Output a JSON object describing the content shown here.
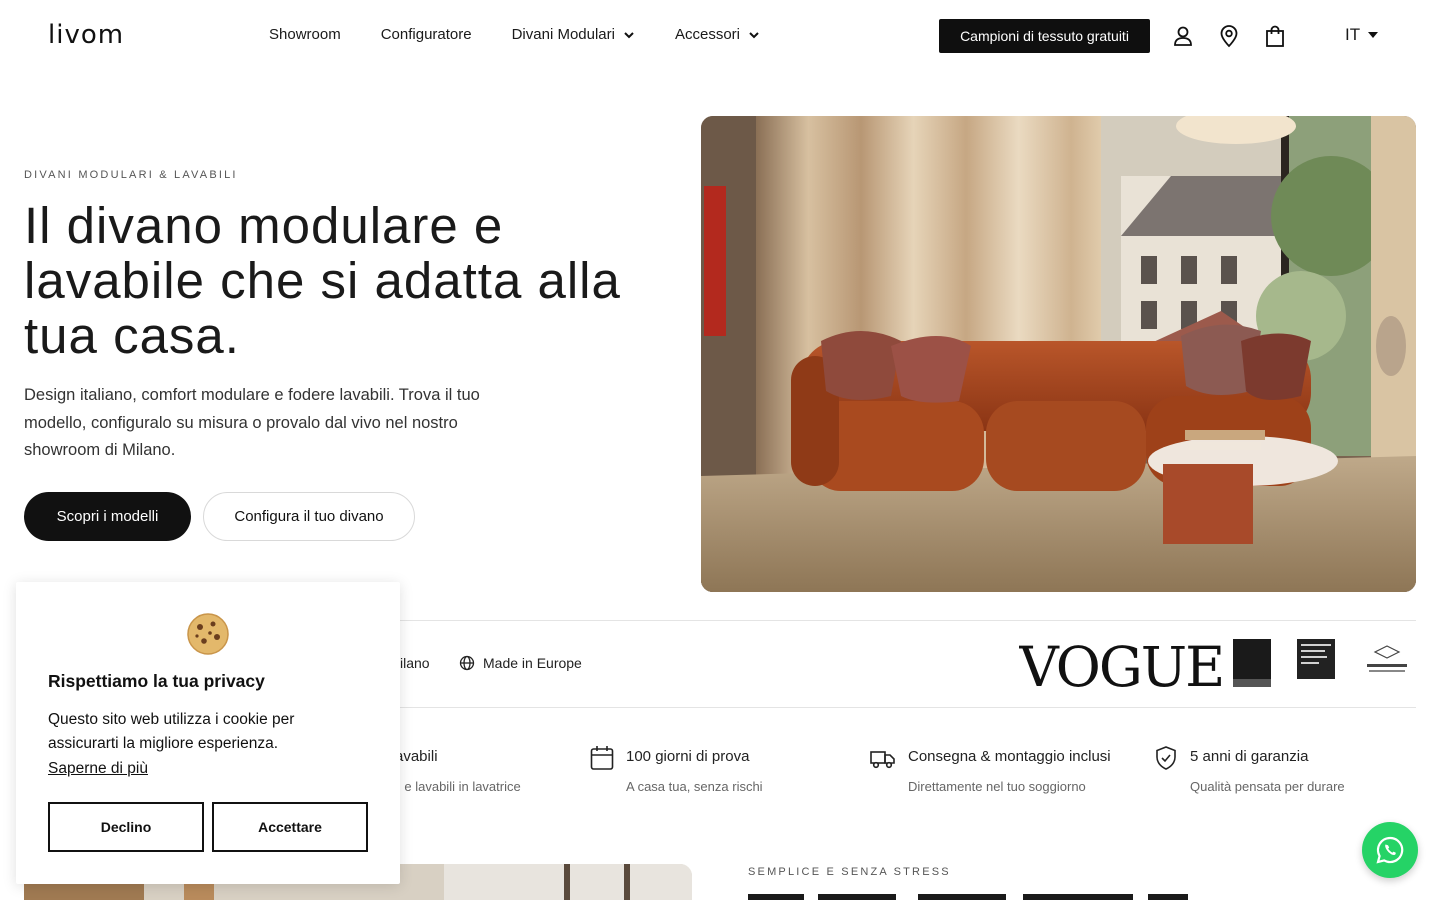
{
  "header": {
    "logo": "livom",
    "nav": [
      "Showroom",
      "Configuratore",
      "Divani Modulari",
      "Accessori"
    ],
    "samples_button": "Campioni di tessuto gratuiti",
    "language": "IT"
  },
  "hero": {
    "eyebrow": "DIVANI MODULARI & LAVABILI",
    "title": "Il divano modulare e lavabile che si adatta alla tua casa.",
    "description": "Design italiano, comfort modulare e fodere lavabili. Trova il tuo modello, configuralo su misura o provalo dal vivo nel nostro showroom di Milano.",
    "primary_button": "Scopri i modelli",
    "secondary_button": "Configura il tuo divano"
  },
  "trust": {
    "showroom_partial": "ilano",
    "made_in": "Made in Europe",
    "press_logo": "VOGUE"
  },
  "features": [
    {
      "title": "avabili",
      "subtitle": "li e lavabili in lavatrice",
      "icon": "washable-icon"
    },
    {
      "title": "100 giorni di prova",
      "subtitle": "A casa tua, senza rischi",
      "icon": "calendar-icon"
    },
    {
      "title": "Consegna & montaggio inclusi",
      "subtitle": "Direttamente nel tuo soggiorno",
      "icon": "truck-icon"
    },
    {
      "title": "5 anni di garanzia",
      "subtitle": "Qualità pensata per durare",
      "icon": "shield-check-icon"
    }
  ],
  "section2": {
    "eyebrow": "SEMPLICE E SENZA STRESS"
  },
  "cookie": {
    "title": "Rispettiamo la tua privacy",
    "text": "Questo sito web utilizza i cookie per assicurarti la migliore esperienza.",
    "link": "Saperne di più",
    "decline": "Declino",
    "accept": "Accettare"
  },
  "colors": {
    "primary": "#111111",
    "sofa": "#a4461e",
    "whatsapp": "#25d366"
  }
}
